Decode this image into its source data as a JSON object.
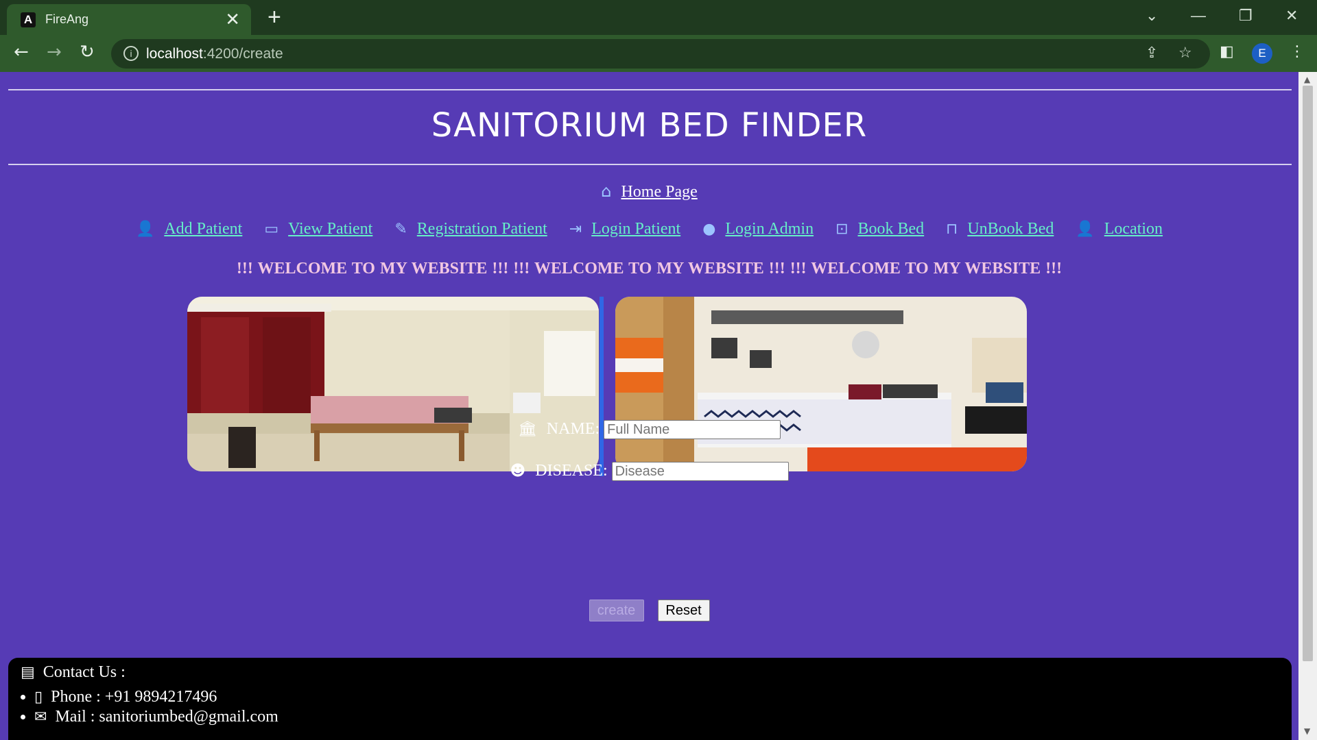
{
  "browser": {
    "tab_title": "FireAng",
    "tab_close": "✕",
    "new_tab": "+",
    "url_host": "localhost",
    "url_path": ":4200/create",
    "profile_initial": "E"
  },
  "site": {
    "title": "SANITORIUM BED FINDER",
    "home_link": "Home Page",
    "nav": [
      {
        "label": "Add Patient",
        "icon": "add-user-icon"
      },
      {
        "label": "View Patient",
        "icon": "list-icon"
      },
      {
        "label": "Registration Patient",
        "icon": "pencil-icon"
      },
      {
        "label": "Login Patient",
        "icon": "login-icon"
      },
      {
        "label": "Login Admin",
        "icon": "person-icon"
      },
      {
        "label": "Book Bed",
        "icon": "bookmark-check-icon"
      },
      {
        "label": "UnBook Bed",
        "icon": "bookmark-icon"
      },
      {
        "label": "Location",
        "icon": "add-user-icon"
      }
    ],
    "welcome_text": "!!! WELCOME TO MY WEBSITE !!!   !!! WELCOME TO MY WEBSITE !!!  !!! WELCOME TO MY WEBSITE !!!"
  },
  "form": {
    "name_label": "NAME:",
    "name_placeholder": "Full Name",
    "disease_label": "DISEASE:",
    "disease_placeholder": "Disease",
    "create_label": "create",
    "reset_label": "Reset"
  },
  "contact": {
    "heading": "Contact Us :",
    "phone": "Phone : +91 9894217496",
    "mail": "Mail : sanitoriumbed@gmail.com"
  },
  "colors": {
    "page_bg": "#563bb5",
    "nav_link": "#66f0c8",
    "welcome": "#f1c7e2",
    "contact_bg": "#000000"
  }
}
